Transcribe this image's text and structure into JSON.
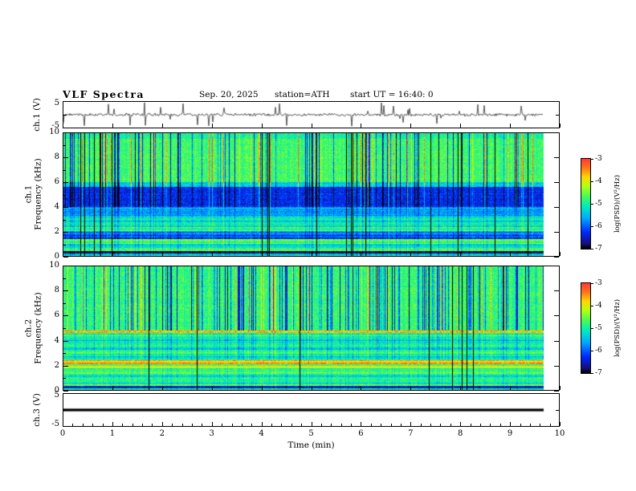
{
  "header": {
    "title": "VLF Spectra",
    "date": "Sep. 20, 2025",
    "station": "station=ATH",
    "start_ut": "start UT  =  16:40: 0"
  },
  "axes": {
    "xlabel": "Time (min)",
    "xlim_min": [
      0,
      10
    ],
    "xticks": [
      0,
      1,
      2,
      3,
      4,
      5,
      6,
      7,
      8,
      9,
      10
    ],
    "data_end_min": 9.7
  },
  "colorbar": {
    "label": "log(PSD)/(V²/Hz)",
    "ticks": [
      -3,
      -4,
      -5,
      -6,
      -7
    ],
    "range_log_psd": [
      -7,
      -3
    ]
  },
  "chart_data": [
    {
      "type": "line",
      "name": "ch1-waveform",
      "ylabel": "ch.1 (V)",
      "ylim": [
        -5,
        5
      ],
      "yticks": [
        5,
        -5
      ],
      "summary": "Broadband noise around 0 V (about ±0.7 V) with frequent impulsive spikes reaching ±5 V, recorded 0–9.7 min"
    },
    {
      "type": "heatmap",
      "name": "ch1-spectrogram",
      "ylabel_line1": "ch.1",
      "ylabel_line2": "Frequency (kHz)",
      "ylim_khz": [
        0,
        10
      ],
      "yticks": [
        0,
        2,
        4,
        6,
        8,
        10
      ],
      "zlabel": "log(PSD)/(V²/Hz)",
      "zlim": [
        -7,
        -3
      ],
      "bands": [
        {
          "freq_khz": [
            6,
            10
          ],
          "log_psd": -4.7,
          "note": "bright green/yellow with dense dark vertical sferic streaks and occasional red bursts"
        },
        {
          "freq_khz": [
            5.6,
            6
          ],
          "log_psd": -5.4,
          "note": "transition band"
        },
        {
          "freq_khz": [
            4,
            5.6
          ],
          "log_psd": -6.3,
          "note": "dark blue quiet band with darker blotches"
        },
        {
          "freq_khz": [
            2.4,
            4
          ],
          "log_psd": -5.5,
          "note": "cyan/blue mottled region"
        },
        {
          "freq_khz": [
            2.0,
            2.35
          ],
          "log_psd": -4.8,
          "note": "bright cyan-green stripe"
        },
        {
          "freq_khz": [
            1.35,
            1.65
          ],
          "log_psd": -6.1,
          "note": "dark stripe"
        },
        {
          "freq_khz": [
            0.95,
            1.35
          ],
          "log_psd": -4.7,
          "note": "yellow-green stripe"
        },
        {
          "freq_khz": [
            0.38,
            0.6
          ],
          "log_psd": -4.6,
          "note": "yellow-green stripe"
        },
        {
          "freq_khz": [
            0.18,
            0.38
          ],
          "log_psd": -7.0,
          "note": "black notch line near bottom"
        }
      ]
    },
    {
      "type": "heatmap",
      "name": "ch2-spectrogram",
      "ylabel_line1": "ch.2",
      "ylabel_line2": "Frequency (kHz)",
      "ylim_khz": [
        0,
        10
      ],
      "yticks": [
        0,
        2,
        4,
        6,
        8,
        10
      ],
      "zlabel": "log(PSD)/(V²/Hz)",
      "zlim": [
        -7,
        -3
      ],
      "bands": [
        {
          "freq_khz": [
            5,
            10
          ],
          "log_psd": -4.8,
          "note": "green with dense dark-blue vertical streaks"
        },
        {
          "freq_khz": [
            4.58,
            4.78
          ],
          "log_psd": -3.8,
          "note": "orange horizontal line"
        },
        {
          "freq_khz": [
            2.4,
            4.58
          ],
          "log_psd": -5.0,
          "note": "green with fine horizontal striping"
        },
        {
          "freq_khz": [
            2.05,
            2.35
          ],
          "log_psd": -3.6,
          "note": "red horizontal band"
        },
        {
          "freq_khz": [
            1.7,
            1.9
          ],
          "log_psd": -3.9,
          "note": "orange horizontal line"
        },
        {
          "freq_khz": [
            0.28,
            1.7
          ],
          "log_psd": -5.0,
          "note": "alternating green/cyan horizontal stripes"
        },
        {
          "freq_khz": [
            0.12,
            0.28
          ],
          "log_psd": -6.4,
          "note": "dark stripe near bottom"
        }
      ]
    },
    {
      "type": "line",
      "name": "ch3-waveform",
      "ylabel": "ch.3 (V)",
      "ylim": [
        -5,
        5
      ],
      "yticks": [
        5,
        -5
      ],
      "summary": "Constant 0 V flat thick line (no signal), 0–9.7 min"
    }
  ]
}
